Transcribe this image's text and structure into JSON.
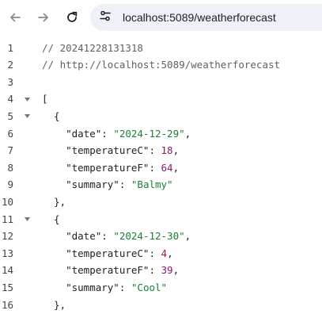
{
  "browser": {
    "url": "localhost:5089/weatherforecast",
    "icons": {
      "back": "arrow-left-icon",
      "forward": "arrow-right-icon",
      "reload": "reload-icon",
      "site": "site-info-icon"
    }
  },
  "editor": {
    "lines": [
      {
        "no": "1",
        "foldable": false,
        "parts": [
          {
            "t": "cm",
            "v": "// 20241228131318"
          }
        ]
      },
      {
        "no": "2",
        "foldable": false,
        "parts": [
          {
            "t": "cm",
            "v": "// http://localhost:5089/weatherforecast"
          }
        ]
      },
      {
        "no": "3",
        "foldable": false,
        "parts": []
      },
      {
        "no": "4",
        "foldable": true,
        "parts": [
          {
            "t": "punc",
            "v": "["
          }
        ]
      },
      {
        "no": "5",
        "foldable": true,
        "parts": [
          {
            "t": "punc",
            "v": "  {"
          }
        ]
      },
      {
        "no": "6",
        "foldable": false,
        "parts": [
          {
            "t": "key",
            "v": "    \"date\""
          },
          {
            "t": "punc",
            "v": ": "
          },
          {
            "t": "str",
            "v": "\"2024-12-29\""
          },
          {
            "t": "punc",
            "v": ","
          }
        ]
      },
      {
        "no": "7",
        "foldable": false,
        "parts": [
          {
            "t": "key",
            "v": "    \"temperatureC\""
          },
          {
            "t": "punc",
            "v": ": "
          },
          {
            "t": "num",
            "v": "18"
          },
          {
            "t": "punc",
            "v": ","
          }
        ]
      },
      {
        "no": "8",
        "foldable": false,
        "parts": [
          {
            "t": "key",
            "v": "    \"temperatureF\""
          },
          {
            "t": "punc",
            "v": ": "
          },
          {
            "t": "num",
            "v": "64"
          },
          {
            "t": "punc",
            "v": ","
          }
        ]
      },
      {
        "no": "9",
        "foldable": false,
        "parts": [
          {
            "t": "key",
            "v": "    \"summary\""
          },
          {
            "t": "punc",
            "v": ": "
          },
          {
            "t": "str",
            "v": "\"Balmy\""
          }
        ]
      },
      {
        "no": "10",
        "foldable": false,
        "parts": [
          {
            "t": "punc",
            "v": "  },"
          }
        ]
      },
      {
        "no": "11",
        "foldable": true,
        "parts": [
          {
            "t": "punc",
            "v": "  {"
          }
        ]
      },
      {
        "no": "12",
        "foldable": false,
        "parts": [
          {
            "t": "key",
            "v": "    \"date\""
          },
          {
            "t": "punc",
            "v": ": "
          },
          {
            "t": "str",
            "v": "\"2024-12-30\""
          },
          {
            "t": "punc",
            "v": ","
          }
        ]
      },
      {
        "no": "13",
        "foldable": false,
        "parts": [
          {
            "t": "key",
            "v": "    \"temperatureC\""
          },
          {
            "t": "punc",
            "v": ": "
          },
          {
            "t": "num",
            "v": "4"
          },
          {
            "t": "punc",
            "v": ","
          }
        ]
      },
      {
        "no": "14",
        "foldable": false,
        "parts": [
          {
            "t": "key",
            "v": "    \"temperatureF\""
          },
          {
            "t": "punc",
            "v": ": "
          },
          {
            "t": "num",
            "v": "39"
          },
          {
            "t": "punc",
            "v": ","
          }
        ]
      },
      {
        "no": "15",
        "foldable": false,
        "parts": [
          {
            "t": "key",
            "v": "    \"summary\""
          },
          {
            "t": "punc",
            "v": ": "
          },
          {
            "t": "str",
            "v": "\"Cool\""
          }
        ]
      },
      {
        "no": "16",
        "foldable": false,
        "parts": [
          {
            "t": "punc",
            "v": "  },"
          }
        ]
      }
    ]
  }
}
